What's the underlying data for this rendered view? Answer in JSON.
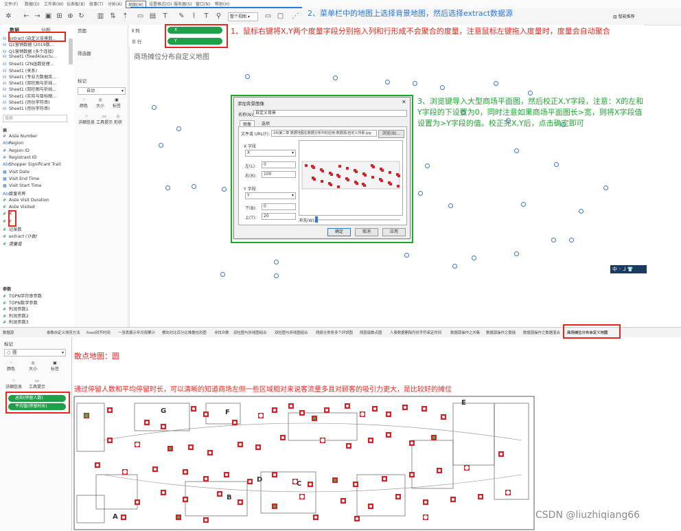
{
  "menubar": {
    "items": [
      "文件(F)",
      "数据(D)",
      "工作表(W)",
      "仪表板(B)",
      "故事(T)",
      "分析(A)",
      "地图(M)",
      "设置格式(O)",
      "服务器(S)",
      "窗口(N)",
      "帮助(H)"
    ]
  },
  "toolbar": {
    "view_mode": "整个视图",
    "smart_label": "智能推荐"
  },
  "data_pane": {
    "tab_data": "数据",
    "tab_analysis": "分析",
    "sources": [
      "extract (自定义背景数...",
      "Q1营销数据 (2019数...",
      "Q1营销数据 (多个连接)",
      "Sheet1 (fixed4(exclu...",
      "Sheet1 (ZN函数处理...",
      "Sheet1 (关系)",
      "Sheet1 (专业力数据库...",
      "Sheet1 (双柱图与折线...",
      "Sheet1 (双柱图与折线...",
      "Sheet1 (实际与目标图...",
      "Sheet1 (月份字符串)",
      "Sheet1 (月份字符串)"
    ],
    "search_placeholder": "搜索",
    "table_label": "表",
    "fields": [
      {
        "icon": "#",
        "name": "Aisle Number"
      },
      {
        "icon": "Abc",
        "name": "Region"
      },
      {
        "icon": "#",
        "name": "Region ID"
      },
      {
        "icon": "#",
        "name": "Registrant ID"
      },
      {
        "icon": "Abc",
        "name": "Shopper Significant Trait"
      },
      {
        "icon": "▦",
        "name": "Visit Date"
      },
      {
        "icon": "▦",
        "name": "Visit End Time"
      },
      {
        "icon": "▦",
        "name": "Visit Start Time"
      },
      {
        "icon": "Abc",
        "name": "度量名称"
      },
      {
        "icon": "#",
        "name": "Aisle Visit Duration"
      },
      {
        "icon": "#",
        "name": "Aisle Visited"
      },
      {
        "icon": "#",
        "name": "X"
      },
      {
        "icon": "#",
        "name": "Y"
      },
      {
        "icon": "#",
        "name": "记录数"
      },
      {
        "icon": "#",
        "name": "extract (计数)"
      },
      {
        "icon": "#",
        "name": "度量值"
      }
    ],
    "params_label": "参数",
    "params": [
      "TOPN字符串参数",
      "TOPN数字参数",
      "利润参数1",
      "利润参数2",
      "利润参数3"
    ]
  },
  "side_cards": {
    "pages": "页面",
    "filters": "筛选器",
    "marks": "标记",
    "mark_type": "自动",
    "color": "颜色",
    "size": "大小",
    "label": "标签",
    "detail": "详细信息",
    "tooltip": "工具提示",
    "shape": "形状"
  },
  "shelves": {
    "columns_label": "列",
    "rows_label": "行",
    "columns_pill": "X",
    "rows_pill": "Y"
  },
  "view": {
    "title": "商场摊位分布自定义地图"
  },
  "dialog": {
    "title": "添加背景图像",
    "name_label": "名称(N):",
    "name_value": "自定义背景",
    "tab_image": "图像",
    "tab_options": "选项",
    "file_label": "文件或 URL(F):",
    "file_value": "24(第二章 数据地图在数据分析中的应用-数据源/自定义背景.jpg",
    "browse": "浏览(B)...",
    "x_field_label": "X 字段",
    "x_field": "X",
    "left_label": "左(L):",
    "left_value": "0",
    "right_label": "右(R):",
    "right_value": "100",
    "y_field_label": "Y 字段",
    "y_field": "Y",
    "bottom_label": "下(B):",
    "bottom_value": "0",
    "top_label": "上(T):",
    "top_value": "20",
    "wash_label": "冲洗(W):",
    "ok": "确定",
    "cancel": "取消",
    "apply": "应用"
  },
  "sheet_tabs": [
    "数据源",
    "参数自定义排序方法",
    "fixed对齐时间",
    "一张表展示年月周累计",
    "横向对比百分比堆叠柱形图",
    "寻找众数",
    "双柱图与折线图组合",
    "双柱图与折线图组合",
    "两极分类条多个环饼图",
    "两层级数点图",
    "人事数据删除",
    "月份字符串定时间",
    "数据源操作之并集",
    "数据源操作之联接",
    "数据源操作之数据混合",
    "商场摊位分布自定义地图"
  ],
  "lower": {
    "marks_label": "标记",
    "mark_type": "圆",
    "color": "颜色",
    "size": "大小",
    "label": "标签",
    "detail": "详细信息",
    "tooltip": "工具提示",
    "pill_color": "总和(停留人数)",
    "pill_size": "平均值(停留时长)",
    "room_letters": [
      "G",
      "F",
      "E",
      "C",
      "B",
      "A",
      "D"
    ]
  },
  "annotations": {
    "step1": "1、鼠标右键将X,Y两个度量字段分别拖入列和行形成不会聚合的度量，注意鼠标左键拖入度量时，度量会自动聚合",
    "step2": "2、菜单栏中的地图上选择背景地图，然后选择extract数据源",
    "step3": "3、浏览键导入大型商场平面图，然后校正X,Y字段，注意：X的左和Y字段的下设置为0，同时注意如果商场平面图长>宽，则将X字段值设置为>Y字段的值。校正完X,Y后，点击确定即可",
    "scatter_map": "散点地图：圆",
    "insight": "通过停留人数和平均停留时长，可以清晰的知道商场左侧一些区域相对来说客流量多且对顾客的吸引力更大，是比较好的摊位"
  },
  "ime_badge": "中",
  "watermark": "CSDN @liuzhiqiang66",
  "colors": {
    "accent_green": "#1e9f4a",
    "annotation_red": "#e8241c",
    "annotation_green": "#1aa92d",
    "point_blue": "#3d78c3",
    "marker_red": "#d4242a"
  }
}
